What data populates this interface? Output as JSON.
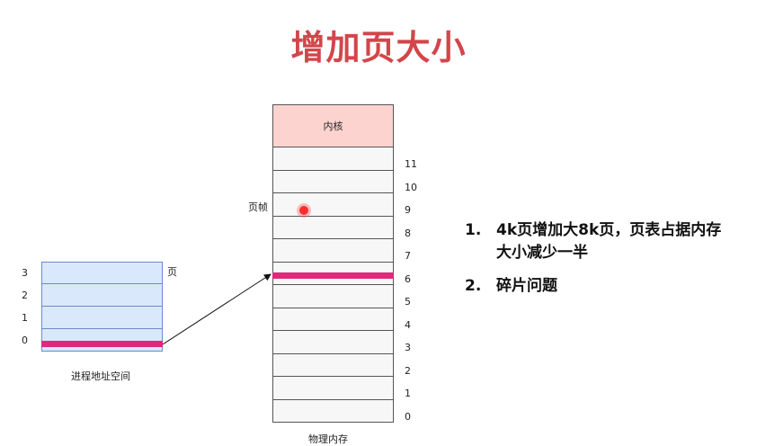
{
  "title": "增加页大小",
  "physical_memory": {
    "kernel_label": "内核",
    "frame_label": "页帧",
    "caption": "物理内存",
    "frame_numbers": [
      "11",
      "10",
      "9",
      "8",
      "7",
      "6",
      "5",
      "4",
      "3",
      "2",
      "1",
      "0"
    ]
  },
  "process_space": {
    "page_label": "页",
    "caption": "进程地址空间",
    "page_numbers": [
      "3",
      "2",
      "1",
      "0"
    ]
  },
  "points": [
    {
      "num": "1.",
      "text": "4k页增加大8k页，页表占据内存",
      "text2": "大小减少一半"
    },
    {
      "num": "2.",
      "text": "碎片问题"
    }
  ],
  "colors": {
    "title": "#d2464b",
    "kernel": "#fdd3cf",
    "page_fill": "#dae8fc",
    "highlight": "#e0297a"
  }
}
